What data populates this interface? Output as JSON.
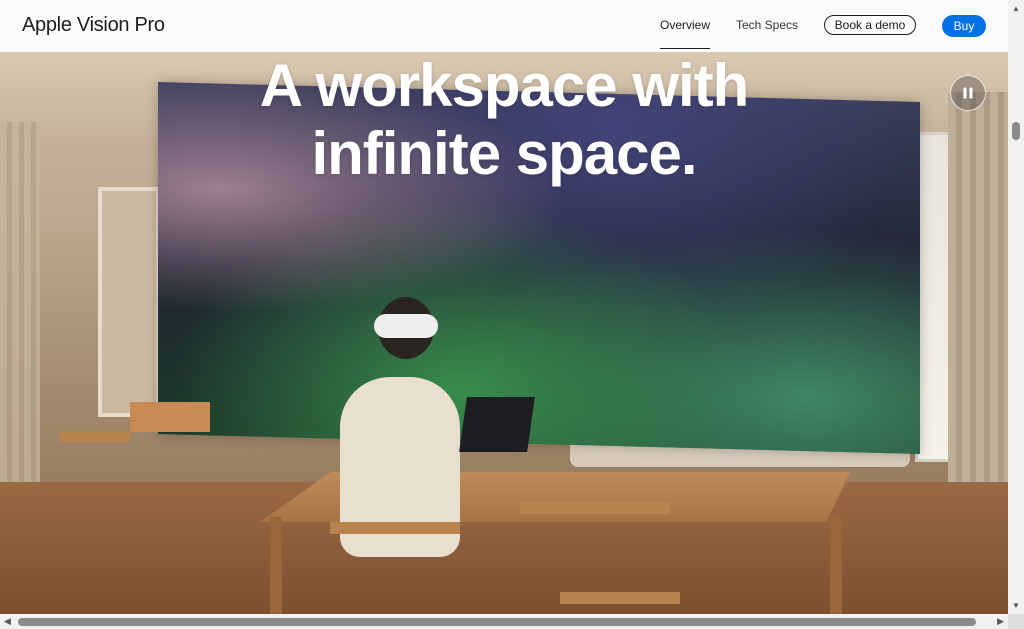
{
  "nav": {
    "brand": "Apple Vision Pro",
    "links": [
      "Overview",
      "Tech Specs"
    ],
    "demo_button": "Book a demo",
    "buy_button": "Buy"
  },
  "hero": {
    "headline_line1": "A workspace with",
    "headline_line2": "infinite space.",
    "pause_icon": "pause-icon"
  },
  "colors": {
    "accent": "#0071e3",
    "nav_bg": "#fbfbfd",
    "text": "#1d1d1f"
  }
}
